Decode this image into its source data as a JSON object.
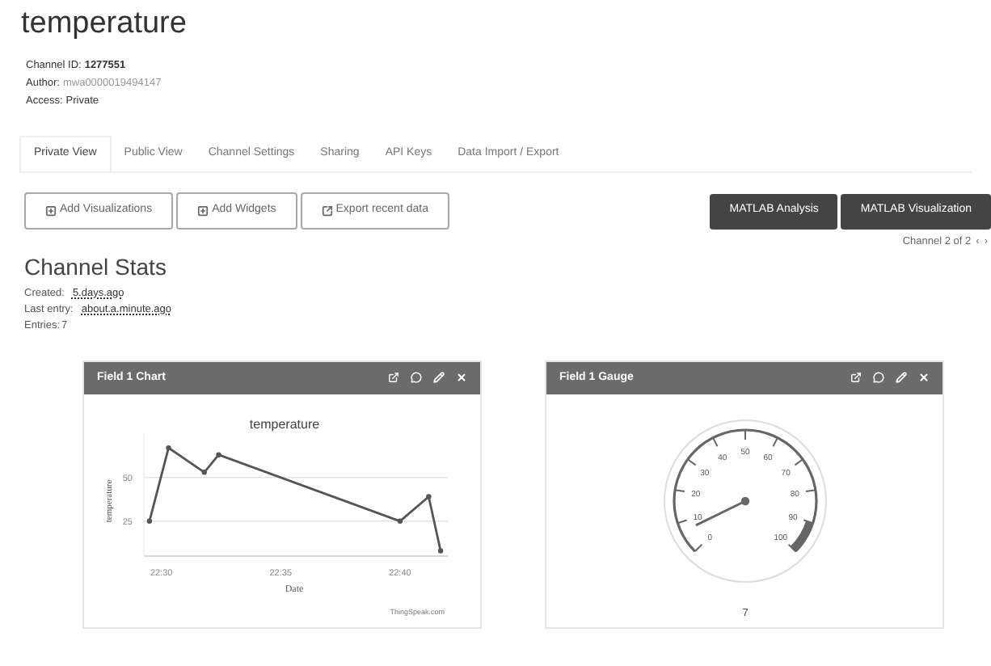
{
  "title": "temperature",
  "channel_info": [
    {
      "label": "Channel ID:",
      "value": "1277551",
      "kind": "bold"
    },
    {
      "label": "Author:",
      "value": "mwa0000019494147",
      "kind": "muted"
    },
    {
      "label": "Access:",
      "value": "Private",
      "kind": "plain"
    }
  ],
  "tabs": [
    {
      "label": "Private View",
      "selected": true
    },
    {
      "label": "Public View",
      "selected": false
    },
    {
      "label": "Channel Settings",
      "selected": false
    },
    {
      "label": "Sharing",
      "selected": false
    },
    {
      "label": "API Keys",
      "selected": false
    },
    {
      "label": "Data Import / Export",
      "selected": false
    }
  ],
  "actions": [
    {
      "label": "Add Visualizations",
      "kind": "add"
    },
    {
      "label": "Add Widgets",
      "kind": "add"
    },
    {
      "label": "Export recent data",
      "kind": "export"
    }
  ],
  "matlab_buttons": [
    "MATLAB Analysis",
    "MATLAB Visualization"
  ],
  "pager": {
    "text": "Channel 2 of 2",
    "prev": "‹",
    "next": "›"
  },
  "stats": {
    "title": "Channel Stats",
    "items": [
      {
        "label": "Created:",
        "value": "5.days.ago",
        "kind": "link"
      },
      {
        "label": "Last entry:",
        "value": "about.a.minute.ago",
        "kind": "link"
      },
      {
        "label": "Entries:",
        "value": "7",
        "kind": "plain"
      }
    ]
  },
  "widgets": [
    {
      "kind": "chart",
      "title": "Field 1 Chart",
      "credit": "ThingSpeak.com",
      "chart_data": {
        "type": "line",
        "title": "temperature",
        "xlabel": "Date",
        "ylabel": "temperature",
        "x": [
          1349.5,
          1350.3,
          1351.8,
          1352.4,
          1360,
          1361.2,
          1361.7
        ],
        "series": [
          {
            "color": "#555555",
            "marker": "circle",
            "values": [
              25,
              67,
              53,
              63,
              25,
              39,
              8
            ]
          }
        ],
        "xlim": [
          1349.3,
          1361.9
        ],
        "ylim": [
          5,
          75
        ],
        "xticks": [
          {
            "value": 1350,
            "label": "22:30"
          },
          {
            "value": 1355,
            "label": "22:35"
          },
          {
            "value": 1360,
            "label": "22:40"
          }
        ],
        "yticks": [
          25,
          50
        ]
      }
    },
    {
      "kind": "gauge",
      "title": "Field 1 Gauge",
      "ticks": [
        "0",
        "10",
        "20",
        "30",
        "40",
        "50",
        "60",
        "70",
        "80",
        "90",
        "100"
      ],
      "reading": "7"
    }
  ]
}
